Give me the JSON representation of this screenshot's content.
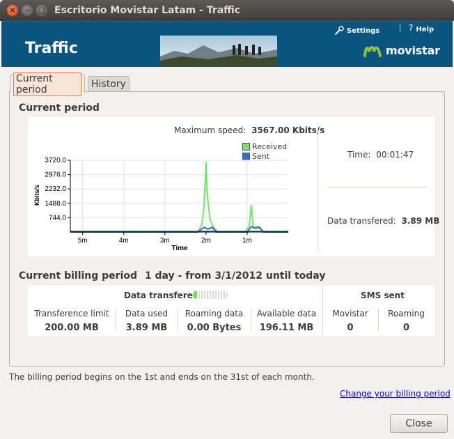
{
  "window": {
    "title": "Escritorio Movistar Latam - Traffic"
  },
  "header": {
    "title": "Traffic",
    "settings_label": "Settings",
    "help_label": "Help",
    "brand": "movistar"
  },
  "tabs": [
    {
      "label": "Current period",
      "active": true
    },
    {
      "label": "History",
      "active": false
    }
  ],
  "current_period": {
    "section_title": "Current period",
    "max_speed_label": "Maximum speed:",
    "max_speed_value": "3567.00 Kbits/s",
    "time_label": "Time:",
    "time_value": "00:01:47",
    "data_label": "Data transfered:",
    "data_value": "3.89 MB"
  },
  "chart_data": {
    "type": "line",
    "xlabel": "Time",
    "ylabel": "Kbits/s",
    "x_ticks": [
      "5m",
      "4m",
      "3m",
      "2m",
      "1m"
    ],
    "y_ticks": [
      "3720.0",
      "2976.0",
      "2232.0",
      "1488.0",
      "744.0"
    ],
    "ylim": [
      0,
      3720
    ],
    "xlim_minutes_ago": [
      5.3,
      0
    ],
    "legend_placement": "top-right",
    "series": [
      {
        "name": "Received",
        "color": "#78e36e",
        "points": [
          [
            5.3,
            0
          ],
          [
            2.2,
            0
          ],
          [
            2.1,
            400
          ],
          [
            2.05,
            1300
          ],
          [
            2.0,
            3600
          ],
          [
            1.97,
            1900
          ],
          [
            1.9,
            600
          ],
          [
            1.8,
            200
          ],
          [
            1.7,
            0
          ],
          [
            1.05,
            0
          ],
          [
            0.95,
            300
          ],
          [
            0.9,
            1400
          ],
          [
            0.85,
            200
          ],
          [
            0.75,
            300
          ],
          [
            0.65,
            100
          ],
          [
            0.6,
            0
          ],
          [
            0,
            0
          ]
        ]
      },
      {
        "name": "Sent",
        "color": "#2b6fcf",
        "points": [
          [
            5.3,
            0
          ],
          [
            2.2,
            0
          ],
          [
            2.05,
            250
          ],
          [
            1.95,
            150
          ],
          [
            1.85,
            250
          ],
          [
            1.75,
            0
          ],
          [
            1.0,
            0
          ],
          [
            0.9,
            280
          ],
          [
            0.8,
            200
          ],
          [
            0.7,
            250
          ],
          [
            0.6,
            0
          ],
          [
            0,
            0
          ]
        ]
      }
    ]
  },
  "billing": {
    "section_title": "Current billing period",
    "period_text": "1 day - from 3/1/2012 until today",
    "data_header": "Data transfered",
    "data_progress_percent": 2,
    "sms_header": "SMS sent",
    "cells": [
      {
        "label": "Transference limit",
        "value": "200.00 MB"
      },
      {
        "label": "Data used",
        "value": "3.89 MB"
      },
      {
        "label": "Roaming data",
        "value": "0.00 Bytes"
      },
      {
        "label": "Available data",
        "value": "196.11 MB"
      },
      {
        "label": "Movistar",
        "value": "0"
      },
      {
        "label": "Roaming",
        "value": "0"
      }
    ]
  },
  "footer": {
    "note": "The billing period begins on the 1st and ends on the 31st of each month.",
    "link": "Change your billing period",
    "close_label": "Close"
  }
}
